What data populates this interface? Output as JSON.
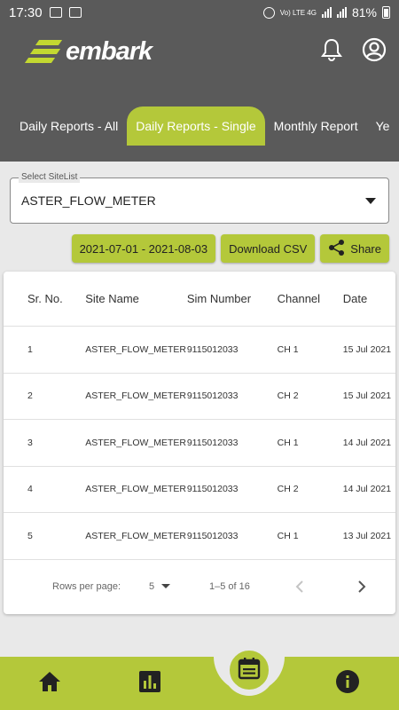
{
  "status_bar": {
    "time": "17:30",
    "network": "Vo) LTE 4G",
    "battery": "81%"
  },
  "app": {
    "logo_text": "embark"
  },
  "tabs": [
    {
      "label": "Daily Reports - All"
    },
    {
      "label": "Daily Reports - Single"
    },
    {
      "label": "Monthly Report"
    },
    {
      "label": "Ye"
    }
  ],
  "select": {
    "label": "Select SiteList",
    "value": "ASTER_FLOW_METER"
  },
  "actions": {
    "date_range": "2021-07-01 - 2021-08-03",
    "download": "Download CSV",
    "share": "Share"
  },
  "table": {
    "headers": {
      "sr": "Sr. No.",
      "site": "Site Name",
      "sim": "Sim Number",
      "channel": "Channel",
      "date": "Date"
    },
    "rows": [
      {
        "sr": "1",
        "site": "ASTER_FLOW_METER",
        "sim": "9115012033",
        "channel": "CH 1",
        "date": "15 Jul 2021"
      },
      {
        "sr": "2",
        "site": "ASTER_FLOW_METER",
        "sim": "9115012033",
        "channel": "CH 2",
        "date": "15 Jul 2021"
      },
      {
        "sr": "3",
        "site": "ASTER_FLOW_METER",
        "sim": "9115012033",
        "channel": "CH 1",
        "date": "14 Jul 2021"
      },
      {
        "sr": "4",
        "site": "ASTER_FLOW_METER",
        "sim": "9115012033",
        "channel": "CH 2",
        "date": "14 Jul 2021"
      },
      {
        "sr": "5",
        "site": "ASTER_FLOW_METER",
        "sim": "9115012033",
        "channel": "CH 1",
        "date": "13 Jul 2021"
      }
    ]
  },
  "pagination": {
    "rows_per_page_label": "Rows per page:",
    "rows_per_page": "5",
    "range": "1–5 of 16"
  },
  "colors": {
    "accent": "#b4c83a",
    "header_bg": "#5a5a5a",
    "page_bg": "#e9e9e9"
  },
  "bottom_nav": {
    "icons": [
      "home-icon",
      "bar-chart-icon",
      "calendar-icon",
      "info-icon"
    ]
  }
}
